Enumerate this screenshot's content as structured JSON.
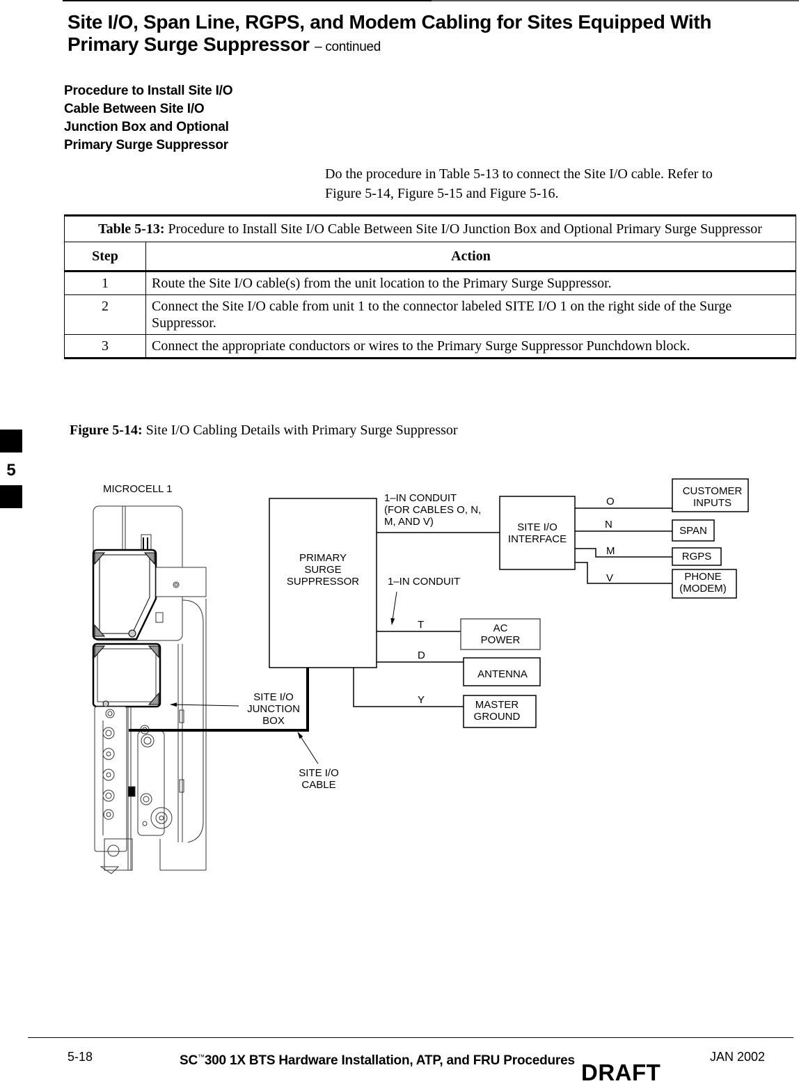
{
  "header": {
    "title_line1": "Site I/O, Span Line, RGPS, and Modem Cabling for Sites Equipped With",
    "title_line2": "Primary Surge Suppressor",
    "continued": "– continued"
  },
  "section": {
    "heading_lines": [
      "Procedure to Install Site I/O",
      "Cable Between Site I/O",
      "Junction Box and Optional",
      "Primary Surge Suppressor"
    ],
    "intro_line1": "Do the procedure in Table 5-13 to connect the Site I/O cable.  Refer to",
    "intro_line2": "Figure 5-14, Figure 5-15 and Figure 5-16."
  },
  "table": {
    "caption_label": "Table 5-13:",
    "caption_text": " Procedure to Install Site I/O Cable Between Site I/O Junction Box and Optional Primary Surge Suppressor",
    "columns": [
      "Step",
      "Action"
    ],
    "rows": [
      {
        "step": "1",
        "action": "Route the Site I/O cable(s) from the unit location to the Primary Surge Suppressor."
      },
      {
        "step": "2",
        "action": "Connect the Site I/O cable from unit 1 to the connector labeled SITE I/O 1 on the right side of the Surge Suppressor."
      },
      {
        "step": "3",
        "action": "Connect the appropriate conductors or wires to the Primary Surge Suppressor Punchdown block."
      }
    ]
  },
  "figure": {
    "caption_label": "Figure 5-14:",
    "caption_text": " Site I/O Cabling Details with Primary Surge Suppressor",
    "labels": {
      "microcell": "MICROCELL 1",
      "suppressor": [
        "PRIMARY",
        "SURGE",
        "SUPPRESSOR"
      ],
      "conduit_top": [
        "1–IN CONDUIT",
        "(FOR CABLES O, N,",
        "M, AND V)"
      ],
      "conduit_mid": "1–IN CONDUIT",
      "interface": [
        "SITE I/O",
        "INTERFACE"
      ],
      "junction_box": [
        "SITE I/O",
        "JUNCTION",
        "BOX"
      ],
      "cable": [
        "SITE I/O",
        "CABLE"
      ]
    },
    "interface_connections": [
      {
        "wire": "O",
        "target": [
          "CUSTOMER",
          "INPUTS"
        ]
      },
      {
        "wire": "N",
        "target": [
          "SPAN"
        ]
      },
      {
        "wire": "M",
        "target": [
          "RGPS"
        ]
      },
      {
        "wire": "V",
        "target": [
          "PHONE",
          "(MODEM)"
        ]
      }
    ],
    "suppressor_connections": [
      {
        "wire": "T",
        "target": [
          "AC",
          "POWER"
        ]
      },
      {
        "wire": "D",
        "target": [
          "ANTENNA"
        ]
      },
      {
        "wire": "Y",
        "target": [
          "MASTER",
          "GROUND"
        ]
      }
    ]
  },
  "chapter_tab": {
    "number": "5"
  },
  "footer": {
    "page": "5-18",
    "title_prefix": "SC",
    "trademark": "™",
    "title_rest": "300 1X BTS Hardware Installation, ATP, and FRU Procedures",
    "date": "JAN 2002",
    "draft": "DRAFT"
  }
}
